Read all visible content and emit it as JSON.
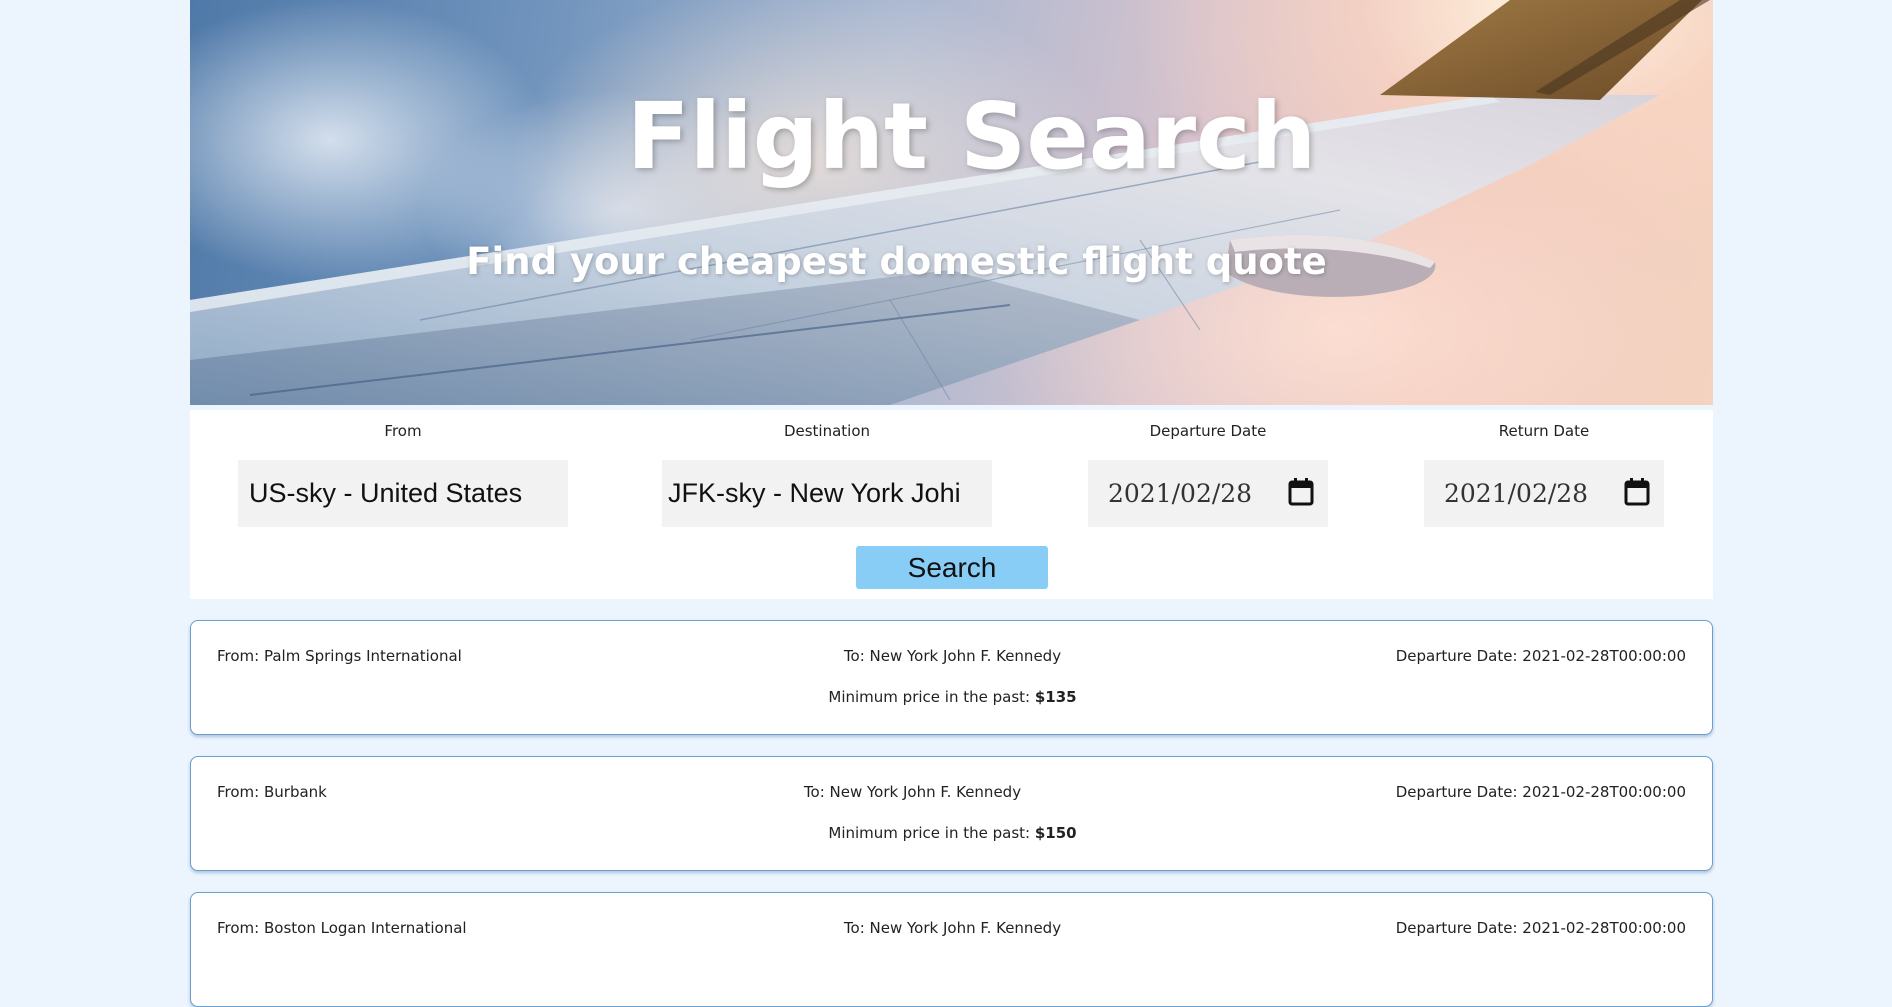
{
  "hero": {
    "title": "Flight Search",
    "subtitle": "Find your cheapest domestic flight quote"
  },
  "form": {
    "from": {
      "label": "From",
      "value": "US-sky - United States"
    },
    "destination": {
      "label": "Destination",
      "value": "JFK-sky - New York Johi"
    },
    "departure_date": {
      "label": "Departure Date",
      "value": "2021/02/28",
      "icon": "calendar-icon"
    },
    "return_date": {
      "label": "Return Date",
      "value": "2021/02/28",
      "icon": "calendar-icon"
    },
    "search_label": "Search"
  },
  "results": [
    {
      "from": "From: Palm Springs International",
      "to": "To: New York John F. Kennedy",
      "departure": "Departure Date: 2021-02-28T00:00:00",
      "price_prefix": "Minimum price in the past: ",
      "price": "$135"
    },
    {
      "from": "From: Burbank",
      "to": "To: New York John F. Kennedy",
      "departure": "Departure Date: 2021-02-28T00:00:00",
      "price_prefix": "Minimum price in the past: ",
      "price": "$150"
    },
    {
      "from": "From: Boston Logan International",
      "to": "To: New York John F. Kennedy",
      "departure": "Departure Date: 2021-02-28T00:00:00",
      "price_prefix": "",
      "price": ""
    }
  ],
  "colors": {
    "page_bg": "#ecf5fe",
    "button_bg": "#88cdf6",
    "card_border": "#6a9fd2"
  }
}
